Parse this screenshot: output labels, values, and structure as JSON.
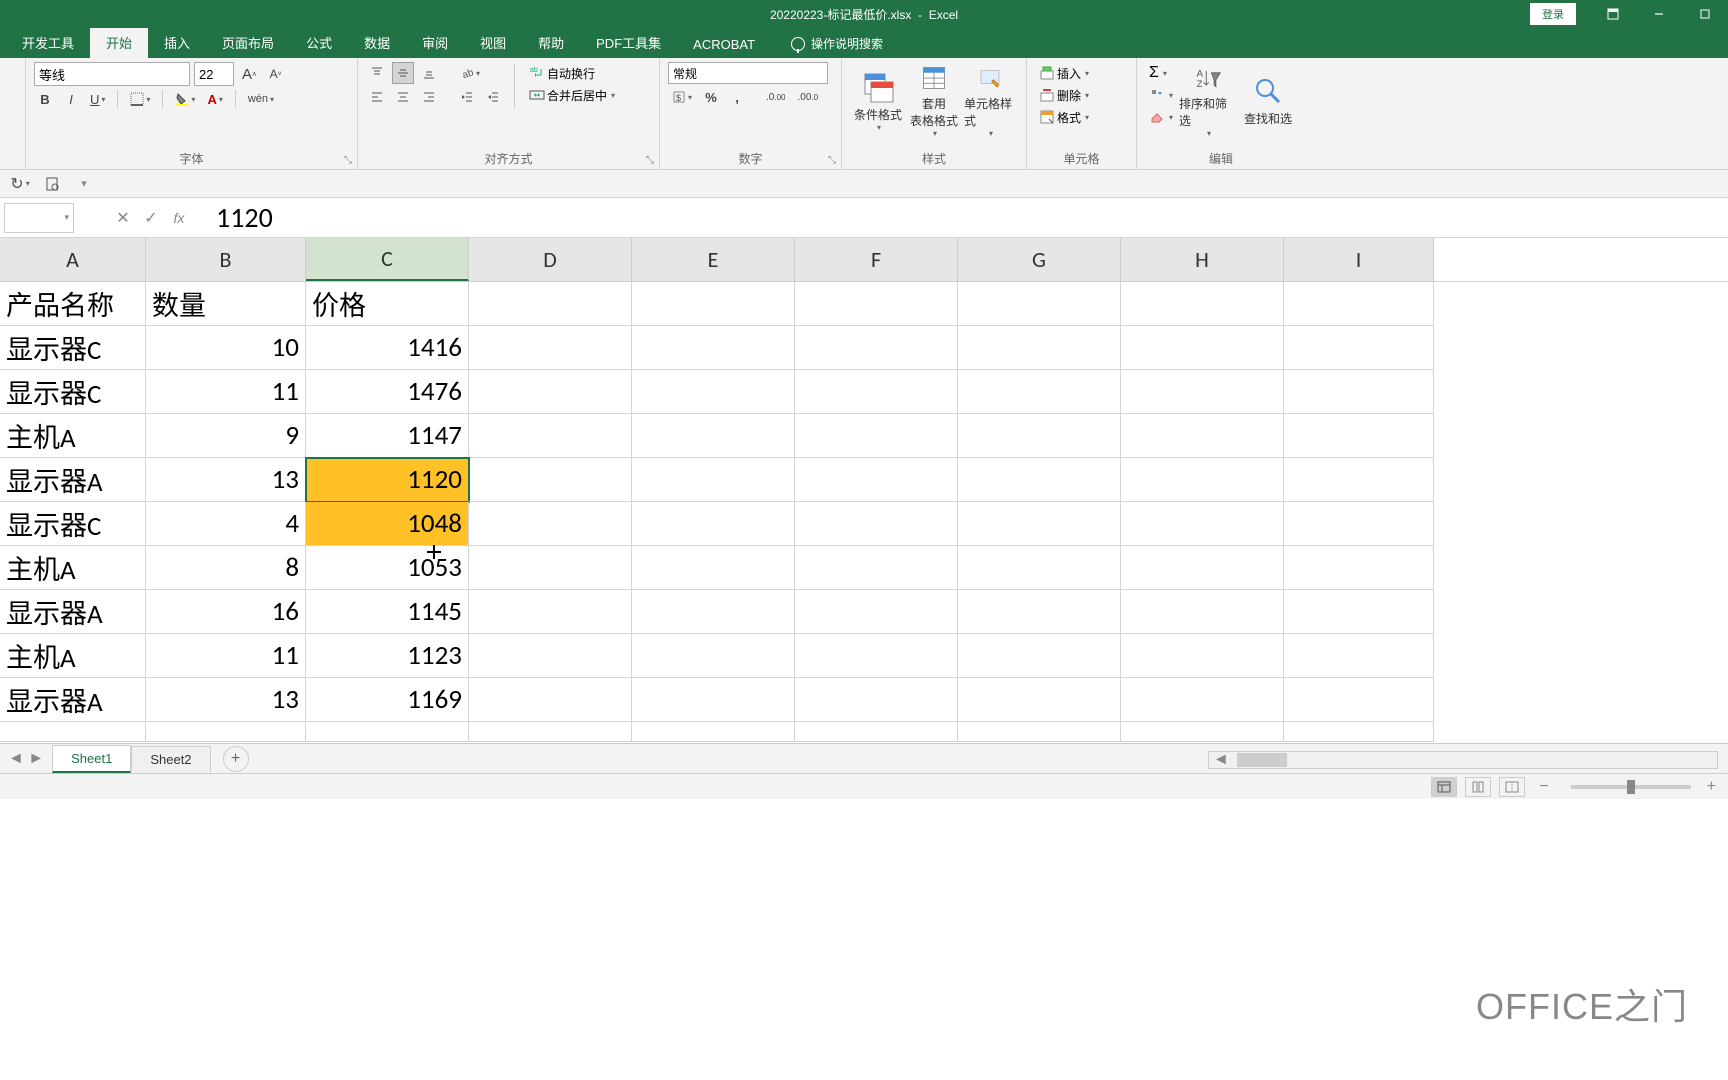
{
  "title": {
    "filename": "20220223-标记最低价.xlsx",
    "app": "Excel"
  },
  "titleRight": {
    "login": "登录"
  },
  "tabs": {
    "items": [
      "开发工具",
      "开始",
      "插入",
      "页面布局",
      "公式",
      "数据",
      "审阅",
      "视图",
      "帮助",
      "PDF工具集",
      "ACROBAT"
    ],
    "active": 1,
    "tellMe": "操作说明搜索"
  },
  "ribbon": {
    "font": {
      "name": "等线",
      "size": "22",
      "label": "字体",
      "bold": "B",
      "italic": "I",
      "underline": "U",
      "phonetic": "wén"
    },
    "align": {
      "label": "对齐方式",
      "wrap": "自动换行",
      "merge": "合并后居中"
    },
    "number": {
      "label": "数字",
      "format": "常规"
    },
    "styles": {
      "label": "样式",
      "cond": "条件格式",
      "table": "套用\n表格格式",
      "cell": "单元格样式"
    },
    "cells": {
      "label": "单元格",
      "insert": "插入",
      "delete": "删除",
      "format": "格式"
    },
    "editing": {
      "label": "编辑",
      "sort": "排序和筛选",
      "find": "查找和选"
    }
  },
  "formulaBar": {
    "nameBox": "",
    "value": "1120"
  },
  "grid": {
    "columns": [
      "A",
      "B",
      "C",
      "D",
      "E",
      "F",
      "G",
      "H",
      "I"
    ],
    "activeCol": 2,
    "headers": [
      "产品名称",
      "数量",
      "价格"
    ],
    "rows": [
      {
        "a": "显示器C",
        "b": "10",
        "c": "1416",
        "hl": false
      },
      {
        "a": "显示器C",
        "b": "11",
        "c": "1476",
        "hl": false
      },
      {
        "a": "主机A",
        "b": "9",
        "c": "1147",
        "hl": false
      },
      {
        "a": "显示器A",
        "b": "13",
        "c": "1120",
        "hl": true,
        "selected": true
      },
      {
        "a": "显示器C",
        "b": "4",
        "c": "1048",
        "hl": true
      },
      {
        "a": "主机A",
        "b": "8",
        "c": "1053",
        "hl": false
      },
      {
        "a": "显示器A",
        "b": "16",
        "c": "1145",
        "hl": false
      },
      {
        "a": "主机A",
        "b": "11",
        "c": "1123",
        "hl": false
      },
      {
        "a": "显示器A",
        "b": "13",
        "c": "1169",
        "hl": false
      }
    ]
  },
  "sheets": {
    "tabs": [
      "Sheet1",
      "Sheet2"
    ],
    "active": 0
  },
  "watermark": "OFFICE之门"
}
